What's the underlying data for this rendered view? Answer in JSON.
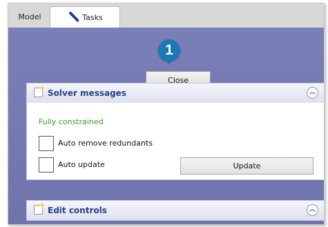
{
  "tabs": [
    {
      "label": "Model"
    },
    {
      "label": "Tasks",
      "icon": "pencil-icon"
    }
  ],
  "badge": {
    "number": "1",
    "color": "#1d77b7"
  },
  "close_button": {
    "label": "Close"
  },
  "solver_messages": {
    "title": "Solver messages",
    "status": "Fully constrained",
    "status_color": "#3a9a2a",
    "auto_remove_redundants": {
      "label": "Auto remove redundants",
      "checked": false
    },
    "auto_update": {
      "label": "Auto update",
      "checked": false
    },
    "update_button": {
      "label": "Update"
    },
    "collapse_icon": "double-chevron-up-icon"
  },
  "edit_controls": {
    "title": "Edit controls",
    "collapse_icon": "double-chevron-up-icon"
  },
  "colors": {
    "panel_background": "#7a7fb7",
    "section_title": "#2b3f86"
  }
}
